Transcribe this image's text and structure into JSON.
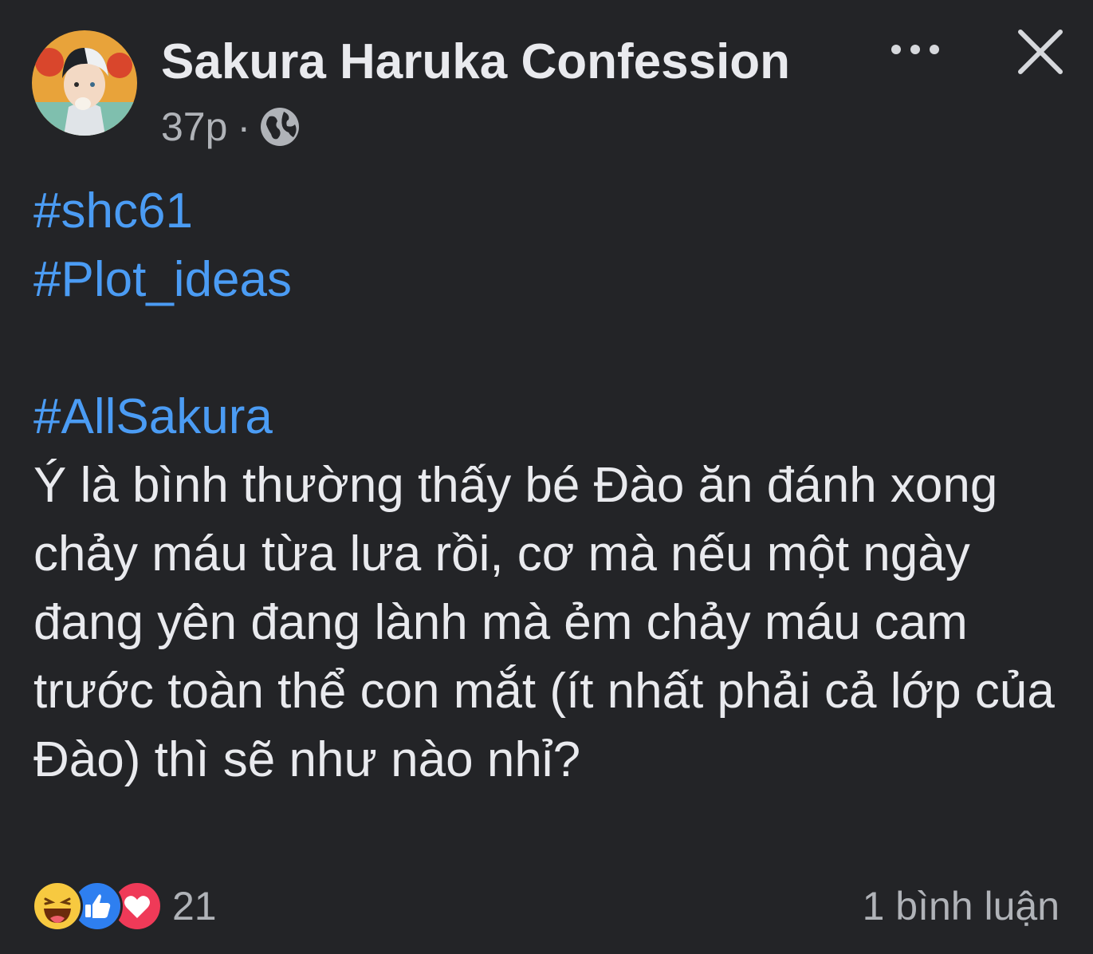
{
  "post": {
    "author": "Sakura Haruka Confession",
    "time": "37p",
    "separator": "·",
    "privacy_icon": "globe-icon",
    "more_icon": "more-horizontal-icon",
    "close_icon": "close-icon",
    "hashtags_top": [
      "#shc61",
      "#Plot_ideas"
    ],
    "hashtag_body": "#AllSakura",
    "body": "Ý là bình thường thấy bé Đào ăn đánh xong chảy máu từa lưa rồi, cơ mà nếu một ngày đang yên đang lành mà ẻm chảy máu cam trước toàn thể con mắt (ít nhất phải cả lớp của Đào) thì sẽ như nào nhỉ?"
  },
  "footer": {
    "reaction_icons": [
      "haha-icon",
      "like-icon",
      "love-icon"
    ],
    "reaction_count": "21",
    "comment_count": "1 bình luận"
  },
  "colors": {
    "background": "#232427",
    "hashtag": "#4b9cf4",
    "text": "#e9eaee",
    "secondary_text": "#b0b3b8"
  }
}
